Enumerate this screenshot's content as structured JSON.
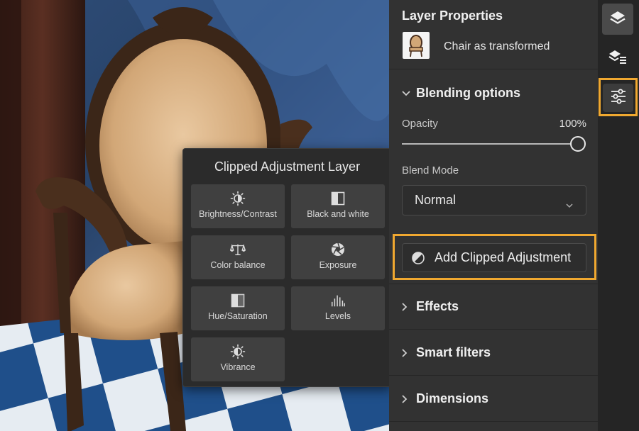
{
  "popover": {
    "title": "Clipped Adjustment Layer",
    "tiles": [
      {
        "label": "Brightness/Contrast",
        "icon": "brightness-contrast-icon"
      },
      {
        "label": "Black and white",
        "icon": "black-and-white-icon"
      },
      {
        "label": "Color balance",
        "icon": "color-balance-icon"
      },
      {
        "label": "Exposure",
        "icon": "exposure-icon"
      },
      {
        "label": "Hue/Saturation",
        "icon": "hue-saturation-icon"
      },
      {
        "label": "Levels",
        "icon": "levels-icon"
      },
      {
        "label": "Vibrance",
        "icon": "vibrance-icon"
      }
    ]
  },
  "panel": {
    "title": "Layer Properties",
    "layer_name": "Chair as transformed",
    "blending": {
      "label": "Blending options",
      "expanded": true,
      "opacity_label": "Opacity",
      "opacity_value": "100%",
      "opacity_fraction": 1.0,
      "blend_mode_label": "Blend Mode",
      "blend_mode_value": "Normal"
    },
    "add_button": "Add Clipped Adjustment",
    "sections": [
      "Effects",
      "Smart filters",
      "Dimensions"
    ]
  },
  "rail": {
    "items": [
      "layers-icon",
      "layer-properties-icon",
      "adjustments-icon"
    ],
    "active": "layers-icon",
    "highlighted": "adjustments-icon"
  },
  "colors": {
    "highlight": "#f0a830",
    "panel_bg": "#323232",
    "tile_bg": "#404040"
  }
}
